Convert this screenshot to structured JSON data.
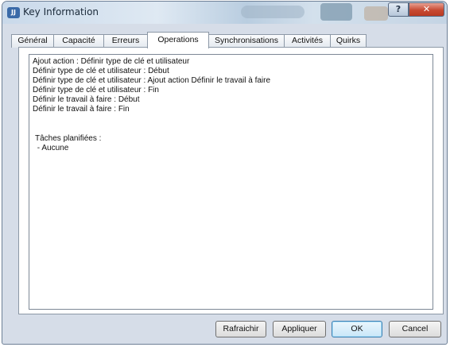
{
  "window": {
    "title": "Key Information",
    "app_icon_text": "JJ",
    "help_glyph": "?",
    "close_glyph": "✕"
  },
  "tabs": [
    {
      "label": "Général",
      "active": false
    },
    {
      "label": "Capacité",
      "active": false
    },
    {
      "label": "Erreurs",
      "active": false
    },
    {
      "label": "Operations",
      "active": true
    },
    {
      "label": "Synchronisations",
      "active": false
    },
    {
      "label": "Activités",
      "active": false
    },
    {
      "label": "Quirks",
      "active": false
    }
  ],
  "operations": {
    "lines": [
      "Ajout action : Définir type de clé et utilisateur",
      "Définir type de clé et utilisateur : Début",
      "Définir type de clé et utilisateur : Ajout action Définir le travail à faire",
      "Définir type de clé et utilisateur : Fin",
      "Définir le travail à faire : Début",
      "Définir le travail à faire : Fin"
    ],
    "scheduled_heading": "Tâches planifiées :",
    "scheduled_items": [
      " - Aucune"
    ]
  },
  "buttons": {
    "refresh": "Rafraichir",
    "apply": "Appliquer",
    "ok": "OK",
    "cancel": "Cancel"
  },
  "colors": {
    "window_frame": "#d6dde8",
    "close_button": "#c74a31",
    "default_button_border": "#3c7fb1"
  }
}
